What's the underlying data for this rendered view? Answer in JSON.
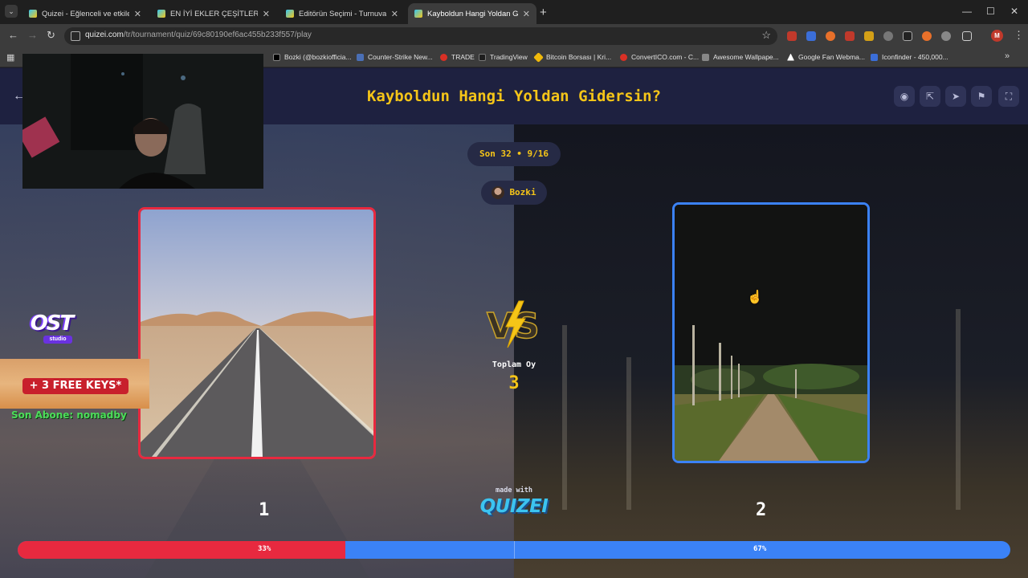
{
  "browser": {
    "tabs": [
      {
        "title": "Quizei - Eğlenceli ve etkileşimli",
        "active": false
      },
      {
        "title": "EN İYİ EKLER ÇEŞİTLERİ - Tier Li",
        "active": false
      },
      {
        "title": "Editörün Seçimi - Turnuva - Qu",
        "active": false
      },
      {
        "title": "Kayboldun Hangi Yoldan Gider",
        "active": true
      }
    ],
    "url_host": "quizei.com",
    "url_path": "/tr/tournament/quiz/69c80190ef6ac455b233f557/play",
    "profile_initial": "M",
    "bookmarks": [
      {
        "label": "Bozki (@bozkiofficia...",
        "color": "#000000"
      },
      {
        "label": "Counter-Strike New...",
        "color": "#4a6fb5"
      },
      {
        "label": "TRADE",
        "color": "#d93025"
      },
      {
        "label": "TradingView",
        "color": "#1e1e1e"
      },
      {
        "label": "Bitcoin Borsası | Kri...",
        "color": "#f0b90b"
      },
      {
        "label": "ConvertICO.com - C...",
        "color": "#d93025"
      },
      {
        "label": "Awesome Wallpape...",
        "color": "#888888"
      },
      {
        "label": "Google Fan Webma...",
        "color": "#ffffff"
      },
      {
        "label": "Iconfinder - 450,000...",
        "color": "#3b6ed8"
      }
    ]
  },
  "header": {
    "title": "Kayboldun Hangi Yoldan Gidersin?"
  },
  "round": {
    "label": "Son 32 • 9/16",
    "user": "Bozki"
  },
  "votes": {
    "label": "Toplam Oy",
    "count": "3"
  },
  "options": {
    "left_number": "1",
    "right_number": "2"
  },
  "results": {
    "left_percent": 33,
    "right_percent": 67,
    "left_label": "33%",
    "right_label": "67%",
    "left_color": "#e8293f",
    "right_color": "#3b82f6"
  },
  "branding": {
    "made_with": "made with",
    "logo": "QUIZEI"
  },
  "overlay": {
    "ost_logo": "OST",
    "ost_sub": "studio",
    "keys_banner": "+ 3 FREE KEYS*",
    "last_sub": "Son Abone: nomadby"
  },
  "colors": {
    "accent": "#f5c518",
    "header_bg": "#1e2140"
  }
}
